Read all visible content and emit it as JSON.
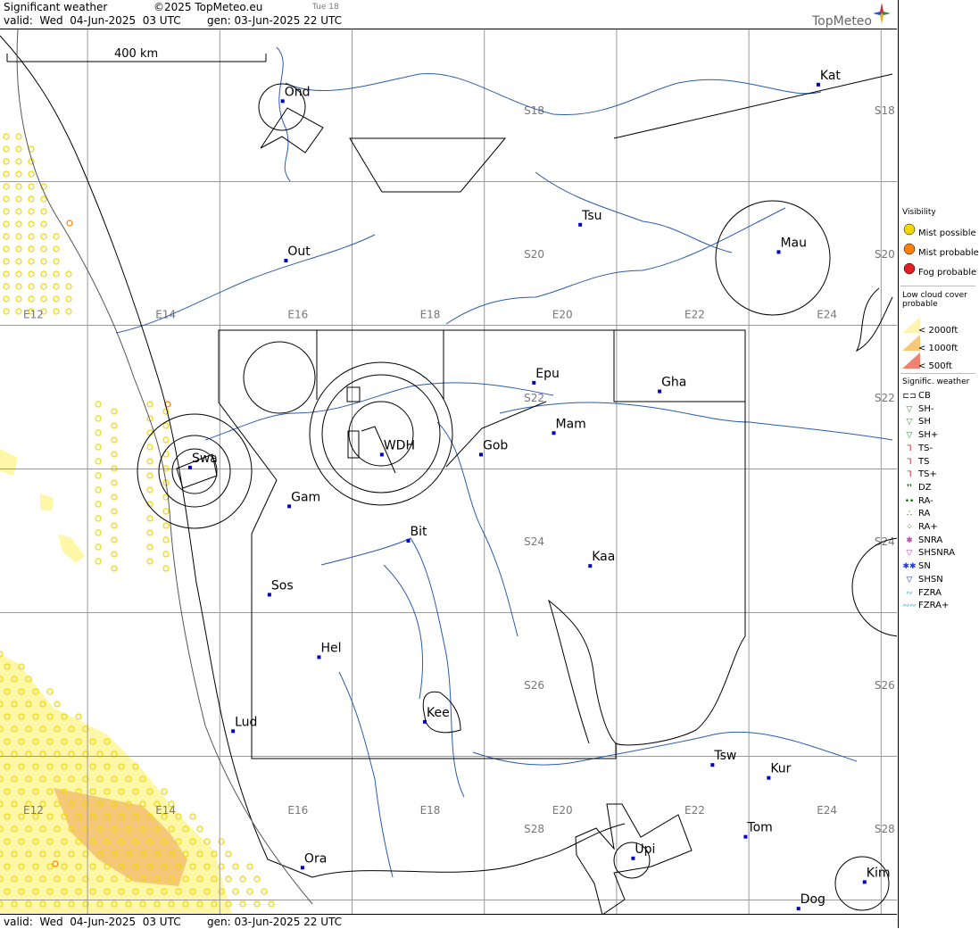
{
  "header": {
    "title": "Significant weather",
    "copyright": "©2025 TopMeteo.eu",
    "day_label": "Tue 18",
    "valid": "valid:  Wed  04-Jun-2025  03 UTC",
    "generated": "gen: 03-Jun-2025 22 UTC",
    "brand": "TopMeteo"
  },
  "map": {
    "scale_label": "400 km",
    "stations": [
      {
        "name": "Ond",
        "lon": 15.95,
        "lat": -17.88
      },
      {
        "name": "Kat",
        "lon": 24.05,
        "lat": -17.65
      },
      {
        "name": "Tsu",
        "lon": 20.45,
        "lat": -19.6
      },
      {
        "name": "Out",
        "lon": 16.0,
        "lat": -20.1
      },
      {
        "name": "Mau",
        "lon": 23.45,
        "lat": -19.98
      },
      {
        "name": "Epu",
        "lon": 19.75,
        "lat": -21.8
      },
      {
        "name": "Gha",
        "lon": 21.65,
        "lat": -21.92
      },
      {
        "name": "Mam",
        "lon": 20.05,
        "lat": -22.5
      },
      {
        "name": "Gob",
        "lon": 18.95,
        "lat": -22.8
      },
      {
        "name": "WDH",
        "lon": 17.45,
        "lat": -22.8
      },
      {
        "name": "Swa",
        "lon": 14.55,
        "lat": -22.98
      },
      {
        "name": "Gam",
        "lon": 16.05,
        "lat": -23.52
      },
      {
        "name": "Bit",
        "lon": 17.85,
        "lat": -24.0
      },
      {
        "name": "Kaa",
        "lon": 20.6,
        "lat": -24.35
      },
      {
        "name": "Sos",
        "lon": 15.75,
        "lat": -24.75
      },
      {
        "name": "Hel",
        "lon": 16.5,
        "lat": -25.62
      },
      {
        "name": "Kee",
        "lon": 18.1,
        "lat": -26.52
      },
      {
        "name": "Lud",
        "lon": 15.2,
        "lat": -26.65
      },
      {
        "name": "Tsw",
        "lon": 22.45,
        "lat": -27.12
      },
      {
        "name": "Kur",
        "lon": 23.3,
        "lat": -27.3
      },
      {
        "name": "Tom",
        "lon": 22.95,
        "lat": -28.12
      },
      {
        "name": "Upi",
        "lon": 21.25,
        "lat": -28.42
      },
      {
        "name": "Ora",
        "lon": 16.25,
        "lat": -28.55
      },
      {
        "name": "Kim",
        "lon": 24.75,
        "lat": -28.75
      },
      {
        "name": "Dog",
        "lon": 23.75,
        "lat": -29.12
      }
    ],
    "lon_labels": [
      {
        "text": "E12",
        "lon": 12
      },
      {
        "text": "E14",
        "lon": 14
      },
      {
        "text": "E16",
        "lon": 16
      },
      {
        "text": "E18",
        "lon": 18
      },
      {
        "text": "E20",
        "lon": 20
      },
      {
        "text": "E22",
        "lon": 22
      },
      {
        "text": "E24",
        "lon": 24
      }
    ],
    "lat_labels": [
      {
        "text": "S18",
        "lat": -18
      },
      {
        "text": "S20",
        "lat": -20
      },
      {
        "text": "S22",
        "lat": -22
      },
      {
        "text": "S24",
        "lat": -24
      },
      {
        "text": "S26",
        "lat": -26
      },
      {
        "text": "S28",
        "lat": -28
      }
    ],
    "colors": {
      "grid": "#999999",
      "boundary": "#555555",
      "river": "#2a5cad",
      "station": "#0000cc",
      "mist": "#f2d600",
      "fog": "#ff7f00",
      "low_cloud_2000": "#ffef99",
      "low_cloud_1000": "#f4c070",
      "low_cloud_500": "#f07060"
    }
  },
  "legend": {
    "visibility_title": "Visibility",
    "visibility": [
      {
        "label": "Mist possible",
        "icon": "mist-possible-icon",
        "color": "#f2d600"
      },
      {
        "label": "Mist probable",
        "icon": "mist-probable-icon",
        "color": "#ff7f00"
      },
      {
        "label": "Fog probable",
        "icon": "fog-probable-icon",
        "color": "#e02020"
      }
    ],
    "low_cloud_title": "Low cloud cover probable",
    "low_cloud": [
      {
        "label": "< 2000ft",
        "color": "#fff3b0"
      },
      {
        "label": "< 1000ft",
        "color": "#f8c878"
      },
      {
        "label": "<   500ft",
        "color": "#f08070"
      }
    ],
    "sigwx_title": "Signific. weather",
    "sigwx": [
      {
        "label": "CB",
        "glyph": "⊏⊐",
        "color": "#000000",
        "icon": "cb-icon"
      },
      {
        "label": "SH-",
        "glyph": "▽",
        "color": "#2a9a2a",
        "icon": "shower-light-icon"
      },
      {
        "label": "SH",
        "glyph": "▽",
        "color": "#2a9a2a",
        "icon": "shower-icon"
      },
      {
        "label": "SH+",
        "glyph": "▽",
        "color": "#2a9a2a",
        "icon": "shower-heavy-icon"
      },
      {
        "label": "TS-",
        "glyph": "Ꞁ",
        "color": "#cc2020",
        "icon": "thunderstorm-light-icon"
      },
      {
        "label": "TS",
        "glyph": "Ꞁ",
        "color": "#cc2020",
        "icon": "thunderstorm-icon"
      },
      {
        "label": "TS+",
        "glyph": "Ꞁ",
        "color": "#cc2020",
        "icon": "thunderstorm-heavy-icon"
      },
      {
        "label": "DZ",
        "glyph": "❜❜",
        "color": "#006400",
        "icon": "drizzle-icon"
      },
      {
        "label": "RA-",
        "glyph": "••",
        "color": "#006400",
        "icon": "rain-light-icon"
      },
      {
        "label": "RA",
        "glyph": "∴",
        "color": "#006400",
        "icon": "rain-icon"
      },
      {
        "label": "RA+",
        "glyph": "⁘",
        "color": "#006400",
        "icon": "rain-heavy-icon"
      },
      {
        "label": "SNRA",
        "glyph": "✱",
        "color": "#c040c0",
        "icon": "snow-rain-icon"
      },
      {
        "label": "SHSNRA",
        "glyph": "▽",
        "color": "#c040c0",
        "icon": "snow-rain-shower-icon"
      },
      {
        "label": "SN",
        "glyph": "✱✱",
        "color": "#2040d0",
        "icon": "snow-icon"
      },
      {
        "label": "SHSN",
        "glyph": "▽",
        "color": "#2040d0",
        "icon": "snow-shower-icon"
      },
      {
        "label": "FZRA",
        "glyph": "∾",
        "color": "#30c0e0",
        "icon": "freezing-rain-icon"
      },
      {
        "label": "FZRA+",
        "glyph": "∾∾",
        "color": "#30c0e0",
        "icon": "freezing-rain-heavy-icon"
      }
    ]
  },
  "footer": {
    "valid": "valid:  Wed  04-Jun-2025  03 UTC",
    "generated": "gen: 03-Jun-2025 22 UTC"
  }
}
